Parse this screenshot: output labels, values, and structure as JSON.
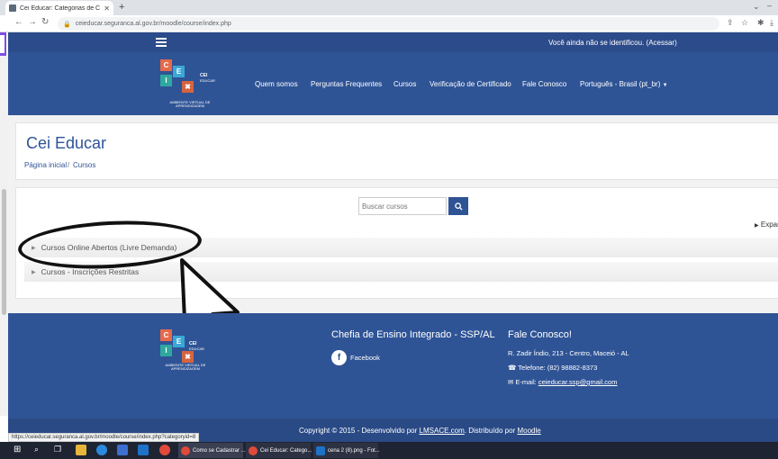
{
  "browser": {
    "tab_title": "Cei Educar: Categorias de Cursos",
    "url": "ceieducar.seguranca.al.gov.br/moodle/course/index.php",
    "status_url": "https://ceieducar.seguranca.al.gov.br/moodle/course/index.php?categoryid=8"
  },
  "navbar": {
    "login_text": "Você ainda não se identificou. (Acessar)"
  },
  "logo": {
    "letters": [
      "C",
      "E",
      "I"
    ],
    "brand_line1": "CEI",
    "brand_line2": "EDUCAR",
    "tagline": "AMBIENTE VIRTUAL DE APRENDIZAGEM"
  },
  "menu": {
    "items": [
      "Quem somos",
      "Perguntas Frequentes",
      "Cursos",
      "Verificação de Certificado",
      "Fale Conosco",
      "Português - Brasil (pt_br)"
    ]
  },
  "page": {
    "title": "Cei Educar",
    "breadcrumb": [
      "Página inicial",
      "Cursos"
    ],
    "breadcrumb_sep": "/"
  },
  "search": {
    "placeholder": "Buscar cursos"
  },
  "expand_label": "Expandir tudo",
  "categories": [
    {
      "name": "Cursos Online Abertos (Livre Demanda)"
    },
    {
      "name": "Cursos - Inscrições Restritas"
    }
  ],
  "footer": {
    "org_title": "Chefia de Ensino Integrado - SSP/AL",
    "facebook_label": "Facebook",
    "contact_title": "Fale Conosco!",
    "address": "R. Zadir Índio, 213 - Centro, Maceió - AL",
    "phone": "Telefone: (82) 98882-8373",
    "email_label": "E-mail:",
    "email": "ceieducar.ssp@gmail.com",
    "copyright_prefix": "Copyright © 2015 - Desenvolvido por",
    "lmsace": "LMSACE.com",
    "distributed": ". Distribuído por",
    "moodle": "Moodle"
  },
  "taskbar": {
    "windows": [
      "Como se Cadastrar ...",
      "Cei Educar: Catego...",
      "cena 2 (8).png - Fot..."
    ]
  },
  "colors": {
    "primary": "#2f5496",
    "navbar": "#2c4b8a",
    "logo_c": "#e66a4a",
    "logo_e": "#3aa7d6",
    "logo_i": "#2fa8a0",
    "logo_x": "#d6643f"
  }
}
